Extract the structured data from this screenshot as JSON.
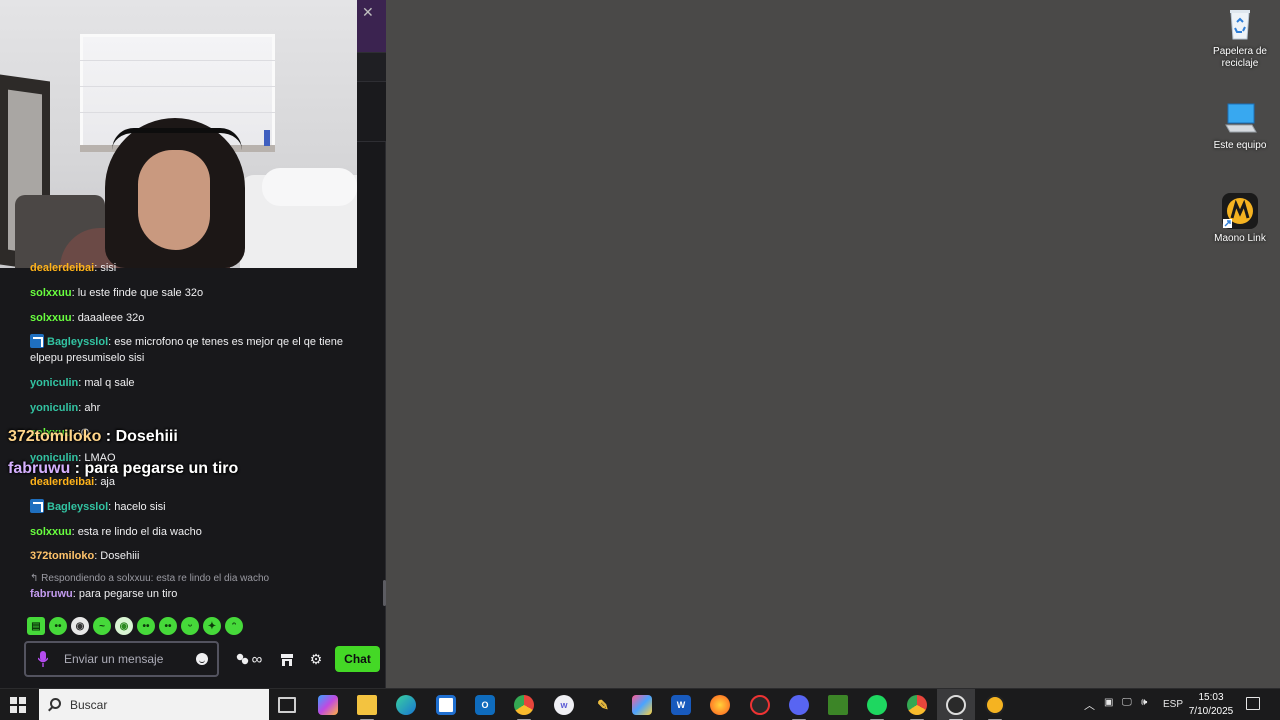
{
  "chat": {
    "messages": [
      {
        "user": "dealerdeibai",
        "color": "#ffb31a",
        "text": ": sisi",
        "badge": false
      },
      {
        "user": "solxxuu",
        "color": "#69ff3f",
        "text": ": lu este finde que sale 32o",
        "badge": false
      },
      {
        "user": "solxxuu",
        "color": "#69ff3f",
        "text": ": daaaleee 32o",
        "badge": false
      },
      {
        "user": "Bagleysslol",
        "color": "#32c3a2",
        "text": ": ese microfono qe tenes es mejor qe el qe tiene elpepu presumiselo sisi",
        "badge": true
      },
      {
        "user": "yoniculin",
        "color": "#32c3a2",
        "text": ": mal q sale",
        "badge": false
      },
      {
        "user": "yoniculin",
        "color": "#32c3a2",
        "text": ": ahr",
        "badge": false
      },
      {
        "user": "solxxuu",
        "color": "#69ff3f",
        "text": ": :O",
        "badge": false
      },
      {
        "user": "yoniculin",
        "color": "#32c3a2",
        "text": ": LMAO",
        "badge": false
      },
      {
        "user": "dealerdeibai",
        "color": "#ffb31a",
        "text": ": aja",
        "badge": false
      },
      {
        "user": "Bagleysslol",
        "color": "#32c3a2",
        "text": ": hacelo sisi",
        "badge": true
      },
      {
        "user": "solxxuu",
        "color": "#69ff3f",
        "text": ": esta re lindo el dia wacho",
        "badge": false
      },
      {
        "user": "372tomiloko",
        "color": "#ffc36a",
        "text": ": Dosehiii",
        "badge": false
      },
      {
        "user": "fabruwu",
        "color": "#c39bef",
        "text": ": para pegarse un tiro",
        "badge": false
      }
    ],
    "reply_note": "↰ Respondiendo a solxxuu: esta re lindo el dia wacho",
    "overlay": [
      {
        "user": "372tomiloko",
        "color": "#ffd58a",
        "text": " : Dosehiii"
      },
      {
        "user": "fabruwu",
        "color": "#d5b0ff",
        "text": " : para pegarse un tiro"
      }
    ],
    "input_placeholder": "Enviar un mensaje",
    "send_label": "Chat",
    "infinity": "∞"
  },
  "desktop": {
    "icons": [
      {
        "label": "Papelera de reciclaje"
      },
      {
        "label": "Este equipo"
      },
      {
        "label": "Maono Link"
      }
    ]
  },
  "taskbar": {
    "search_placeholder": "Buscar",
    "language": "ESP",
    "time": "15:03",
    "date": "7/10/2025"
  }
}
